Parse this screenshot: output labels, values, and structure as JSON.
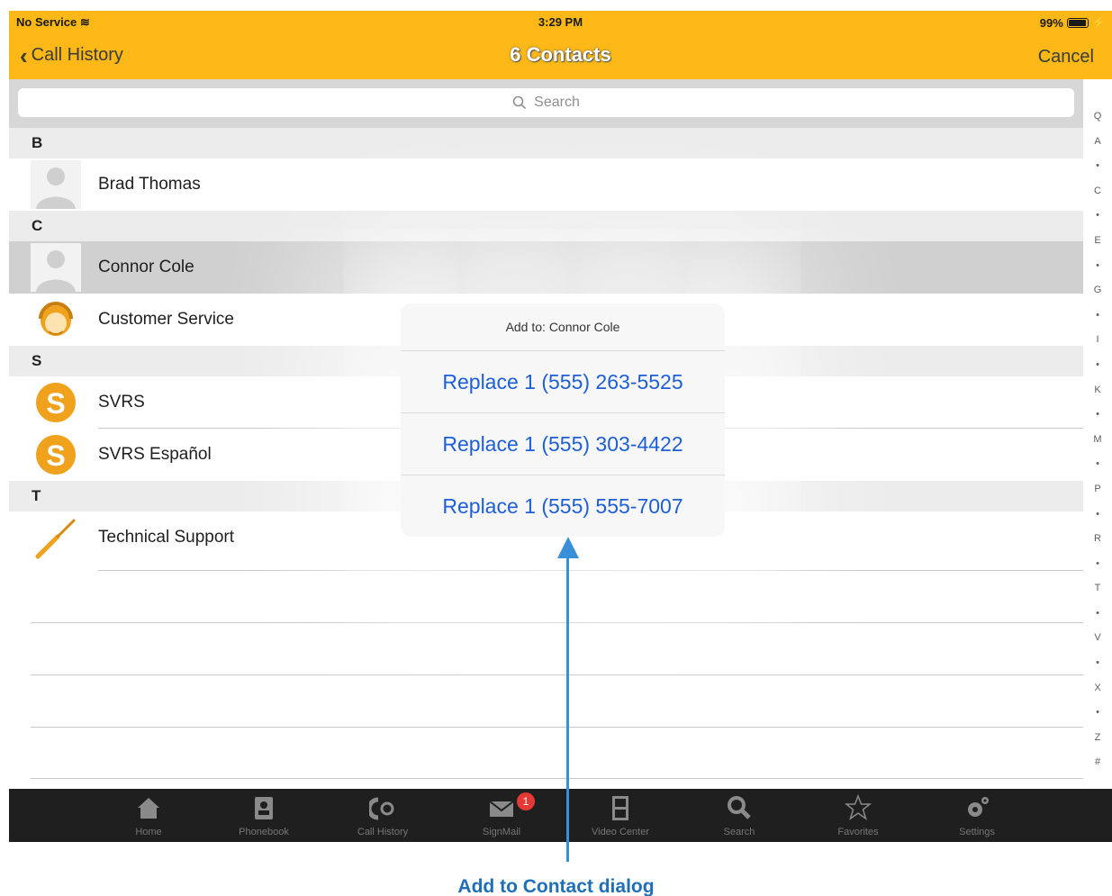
{
  "status": {
    "carrier": "No Service",
    "time": "3:29 PM",
    "battery": "99%",
    "battery_level": 0.99
  },
  "nav": {
    "back_label": "Call History",
    "title": "6 Contacts",
    "cancel_label": "Cancel"
  },
  "search": {
    "placeholder": "Search"
  },
  "sections": [
    {
      "letter": "B",
      "contacts": [
        {
          "name": "Brad Thomas",
          "avatar": "person-silhouette-icon"
        }
      ]
    },
    {
      "letter": "C",
      "contacts": [
        {
          "name": "Connor Cole",
          "avatar": "person-silhouette-icon",
          "selected": true
        },
        {
          "name": "Customer Service",
          "avatar": "headset-agent-icon"
        }
      ]
    },
    {
      "letter": "S",
      "contacts": [
        {
          "name": "SVRS",
          "avatar": "svrs-logo-icon"
        },
        {
          "name": "SVRS Español",
          "avatar": "svrs-logo-icon"
        }
      ]
    },
    {
      "letter": "T",
      "contacts": [
        {
          "name": "Technical Support",
          "avatar": "screwdriver-icon"
        }
      ]
    }
  ],
  "index": [
    "Q",
    "A",
    "•",
    "C",
    "•",
    "E",
    "•",
    "G",
    "•",
    "I",
    "•",
    "K",
    "•",
    "M",
    "•",
    "P",
    "•",
    "R",
    "•",
    "T",
    "•",
    "V",
    "•",
    "X",
    "•",
    "Z",
    "#"
  ],
  "dialog": {
    "title": "Add to: Connor Cole",
    "options": [
      "Replace 1 (555) 263-5525",
      "Replace 1 (555) 303-4422",
      "Replace 1 (555) 555-7007"
    ]
  },
  "tabs": [
    {
      "label": "Home",
      "icon": "home-icon"
    },
    {
      "label": "Phonebook",
      "icon": "phonebook-icon"
    },
    {
      "label": "Call History",
      "icon": "call-history-icon"
    },
    {
      "label": "SignMail",
      "icon": "envelope-icon",
      "badge": "1"
    },
    {
      "label": "Video Center",
      "icon": "film-icon"
    },
    {
      "label": "Search",
      "icon": "search-icon"
    },
    {
      "label": "Favorites",
      "icon": "star-icon"
    },
    {
      "label": "Settings",
      "icon": "gear-icon"
    }
  ],
  "annotation": {
    "label": "Add to Contact dialog"
  },
  "colors": {
    "header": "#fbb817",
    "link": "#1d5fd6",
    "tabbar": "#1f1f1f",
    "annotation": "#1f6fb7",
    "svrs_orange": "#f0a21d"
  }
}
